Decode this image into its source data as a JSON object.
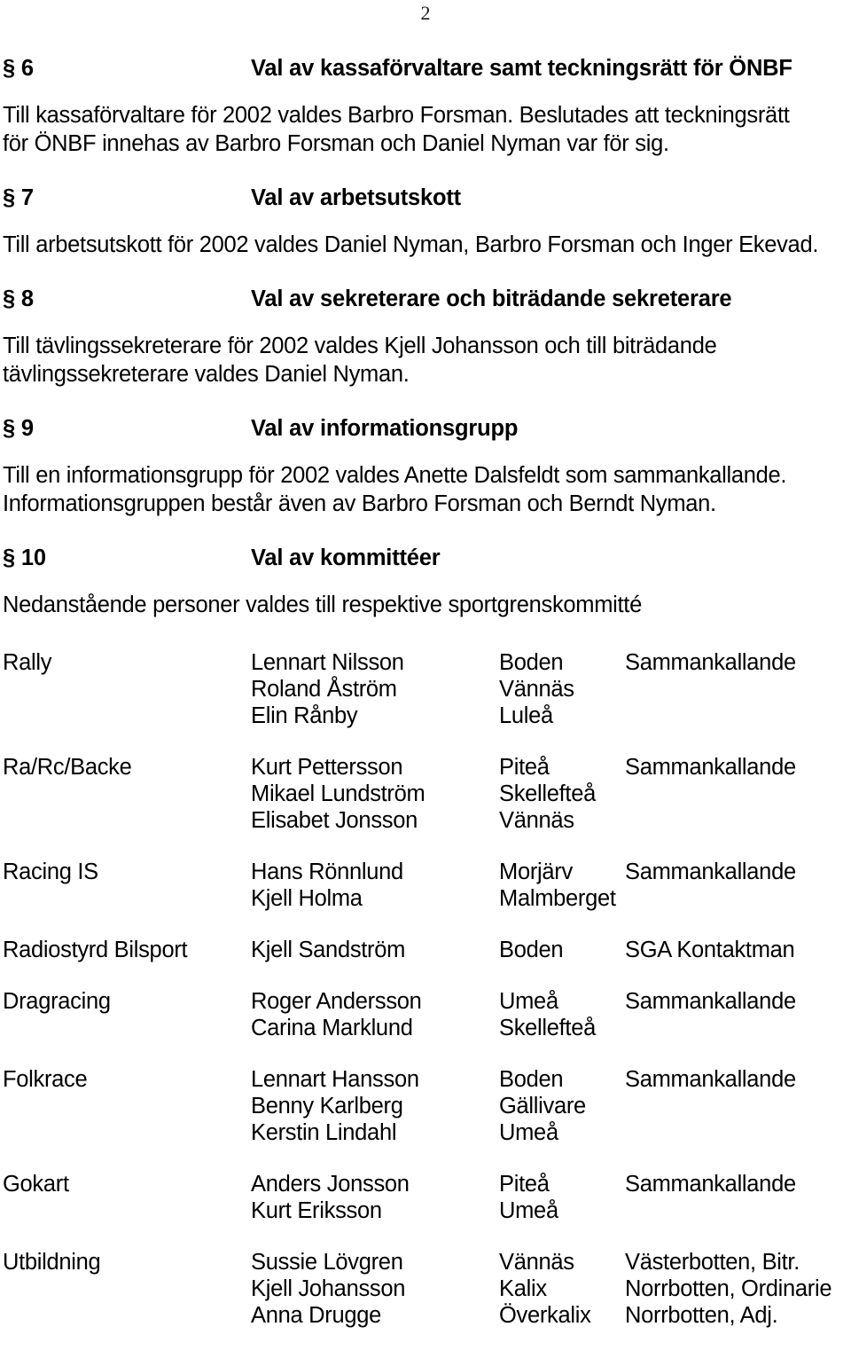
{
  "page": {
    "number": "2"
  },
  "sections": [
    {
      "num": "§ 6",
      "title": "Val av kassaförvaltare samt teckningsrätt för ÖNBF",
      "body": [
        "Till kassaförvaltare för 2002 valdes Barbro Forsman. Beslutades att teckningsrätt",
        "för ÖNBF innehas av Barbro Forsman och Daniel Nyman var för sig."
      ]
    },
    {
      "num": "§ 7",
      "title": "Val av arbetsutskott",
      "body": [
        "Till arbetsutskott för 2002 valdes Daniel Nyman, Barbro Forsman och Inger Ekevad."
      ]
    },
    {
      "num": "§ 8",
      "title": "Val av sekreterare och biträdande sekreterare",
      "body": [
        "Till tävlingssekreterare för 2002 valdes Kjell Johansson och till biträdande",
        "tävlingssekreterare valdes Daniel Nyman."
      ]
    },
    {
      "num": "§ 9",
      "title": "Val av informationsgrupp",
      "body": [
        "Till en informationsgrupp för 2002 valdes Anette Dalsfeldt som sammankallande.",
        "Informationsgruppen består även av Barbro Forsman och Berndt Nyman."
      ]
    },
    {
      "num": "§ 10",
      "title": "Val av kommittéer",
      "body": [
        "Nedanstående personer valdes till respektive sportgrenskommitté"
      ]
    }
  ],
  "committees": [
    {
      "category": "Rally",
      "members": [
        {
          "name": "Lennart Nilsson",
          "city": "Boden",
          "role": "Sammankallande"
        },
        {
          "name": "Roland Åström",
          "city": "Vännäs",
          "role": ""
        },
        {
          "name": "Elin Rånby",
          "city": "Luleå",
          "role": ""
        }
      ]
    },
    {
      "category": "Ra/Rc/Backe",
      "members": [
        {
          "name": "Kurt Pettersson",
          "city": "Piteå",
          "role": "Sammankallande"
        },
        {
          "name": "Mikael Lundström",
          "city": "Skellefteå",
          "role": ""
        },
        {
          "name": "Elisabet Jonsson",
          "city": "Vännäs",
          "role": ""
        }
      ]
    },
    {
      "category": "Racing IS",
      "members": [
        {
          "name": "Hans Rönnlund",
          "city": "Morjärv",
          "role": "Sammankallande"
        },
        {
          "name": "Kjell Holma",
          "city": "Malmberget",
          "role": ""
        }
      ]
    },
    {
      "category": "Radiostyrd Bilsport",
      "members": [
        {
          "name": "Kjell Sandström",
          "city": "Boden",
          "role": "SGA Kontaktman"
        }
      ]
    },
    {
      "category": "Dragracing",
      "members": [
        {
          "name": "Roger Andersson",
          "city": "Umeå",
          "role": "Sammankallande"
        },
        {
          "name": "Carina Marklund",
          "city": "Skellefteå",
          "role": ""
        }
      ]
    },
    {
      "category": "Folkrace",
      "members": [
        {
          "name": "Lennart Hansson",
          "city": "Boden",
          "role": "Sammankallande"
        },
        {
          "name": "Benny Karlberg",
          "city": "Gällivare",
          "role": ""
        },
        {
          "name": "Kerstin Lindahl",
          "city": "Umeå",
          "role": ""
        }
      ]
    },
    {
      "category": "Gokart",
      "members": [
        {
          "name": "Anders Jonsson",
          "city": "Piteå",
          "role": "Sammankallande"
        },
        {
          "name": "Kurt Eriksson",
          "city": "Umeå",
          "role": ""
        }
      ]
    },
    {
      "category": "Utbildning",
      "members": [
        {
          "name": "Sussie Lövgren",
          "city": "Vännäs",
          "role": "Västerbotten, Bitr."
        },
        {
          "name": "Kjell Johansson",
          "city": "Kalix",
          "role": "Norrbotten, Ordinarie"
        },
        {
          "name": "Anna Drugge",
          "city": "Överkalix",
          "role": "Norrbotten, Adj."
        }
      ]
    }
  ]
}
